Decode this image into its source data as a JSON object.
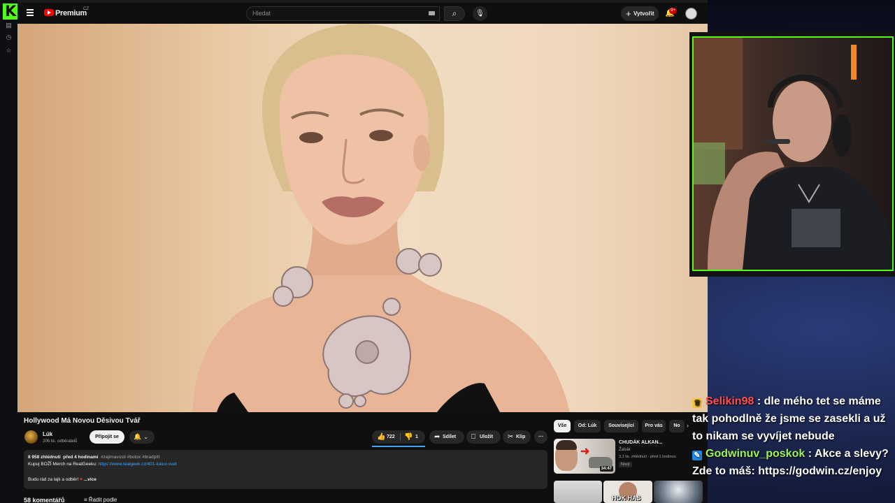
{
  "youtube": {
    "masthead": {
      "logo_text": "Premium",
      "logo_region": "CZ",
      "search_placeholder": "Hledat",
      "create_label": "Vytvořit",
      "notifications_count": "9+"
    },
    "video": {
      "title": "Hollywood Má Novou Děsivou Tvář"
    },
    "channel": {
      "name": "Lúk",
      "subscribers": "206 tis. odběratelů",
      "join_label": "Připojit se"
    },
    "actions": {
      "likes": "722",
      "dislikes": "1",
      "share_label": "Sdílet",
      "save_label": "Uložit",
      "clip_label": "Klip"
    },
    "description": {
      "views": "8 958 zhlédnutí",
      "posted": "před 4 hodinami",
      "tags": "#zajimavosti #botox #bradpitt",
      "merch_text": "Kupuj BOŽÍ Merch na RealGeeku:",
      "merch_link": "https://www.realgeek.cz/401-lukuv-svet",
      "cta": "Budu rád za lajk a odběr!",
      "more_label": "...více"
    },
    "comments": {
      "count": "58 komentářů",
      "sort_label": "Řadit podle"
    },
    "chips": [
      "Vše",
      "Od: Lúk",
      "Související",
      "Pro vás",
      "No"
    ],
    "recommended": [
      {
        "title": "CHUDÁK ALKAN...",
        "channel": "Žabák",
        "meta": "3,1 tis. zhlédnutí · před 1 hodinou",
        "badge": "Nový",
        "duration": "34:47"
      },
      {
        "thumb_text": "HOK HAS"
      }
    ]
  },
  "chat": [
    {
      "user": "Selikin98",
      "message": ": dle mého tet se máme tak pohodlně že jsme se zasekli a už to nikam se vyvíjet nebude",
      "user_color": "#ff4d4d",
      "icon": "crown-icon"
    },
    {
      "user": "Godwinuv_poskok",
      "message": ": Akce a slevy? Zde to máš: https://godwin.cz/enjoy",
      "user_color": "#9bf25a",
      "icon": "bot-icon"
    }
  ],
  "colors": {
    "kick_green": "#53fc18",
    "yt_red": "#ff0000",
    "link_blue": "#3ea6ff"
  }
}
